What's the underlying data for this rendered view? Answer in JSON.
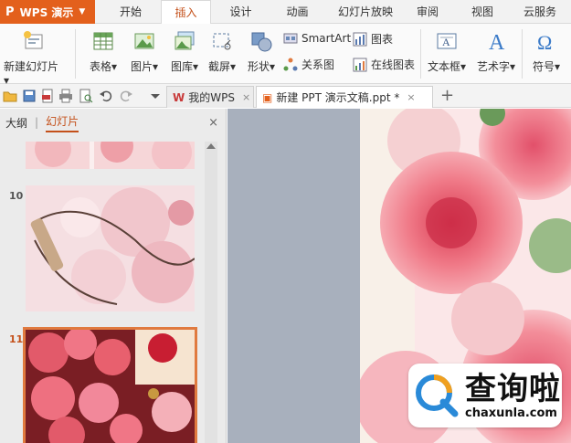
{
  "app": {
    "logo": "P",
    "name": "WPS 演示",
    "accent": "#e3601c"
  },
  "tabs": [
    {
      "label": "开始"
    },
    {
      "label": "插入"
    },
    {
      "label": "设计"
    },
    {
      "label": "动画"
    },
    {
      "label": "幻灯片放映"
    },
    {
      "label": "审阅"
    },
    {
      "label": "视图"
    },
    {
      "label": "云服务"
    }
  ],
  "active_tab": "插入",
  "ribbon": {
    "new_slide": "新建幻灯片",
    "table": "表格",
    "picture": "图片",
    "gallery": "图库",
    "screenshot": "截屏",
    "shape": "形状",
    "smartart": "SmartArt",
    "chart": "图表",
    "relation": "关系图",
    "online_chart": "在线图表",
    "textbox": "文本框",
    "wordart": "艺术字",
    "symbol": "符号",
    "dropdown_marker": "▾"
  },
  "doc_tabs": [
    {
      "label": "我的WPS",
      "close": "×"
    },
    {
      "label": "新建 PPT 演示文稿.ppt *",
      "close": "×"
    }
  ],
  "new_tab_label": "+",
  "left_pane": {
    "outline_label": "大纲",
    "divider": "|",
    "slides_label": "幻灯片",
    "close": "×",
    "slides": [
      {
        "number": ""
      },
      {
        "number": "10"
      },
      {
        "number": "11"
      }
    ],
    "selected_slide": "11"
  },
  "watermark": {
    "main": "查询啦",
    "sub": "chaxunla.com"
  }
}
